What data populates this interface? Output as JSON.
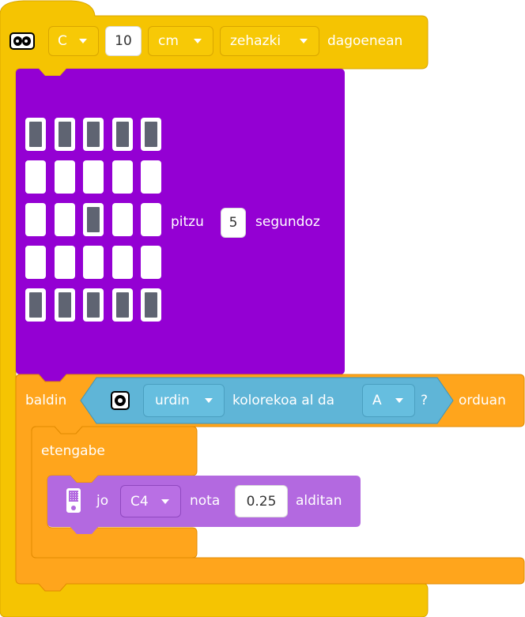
{
  "colors": {
    "sensor_block": "#F5C402",
    "sensor_block_border": "#D9A600",
    "light_block": "#9400D3",
    "control_block": "#FFA51C",
    "control_block_border": "#E08A00",
    "color_sensor_block": "#5FB5D7",
    "sound_block": "#B369E0"
  },
  "hat_block": {
    "icon": "distance-sensor-icon",
    "port": "C",
    "distance_value": "10",
    "unit": "cm",
    "comparison": "zehazki",
    "suffix_label": "dagoenean"
  },
  "light_block": {
    "matrix": [
      [
        1,
        1,
        1,
        1,
        1
      ],
      [
        0,
        0,
        0,
        0,
        0
      ],
      [
        0,
        0,
        1,
        0,
        0
      ],
      [
        0,
        0,
        0,
        0,
        0
      ],
      [
        1,
        1,
        1,
        1,
        1
      ]
    ],
    "action_label": "pitzu",
    "duration_value": "5",
    "unit_label": "segundoz"
  },
  "if_block": {
    "if_label": "baldin",
    "then_label": "orduan",
    "condition": {
      "icon": "color-sensor-icon",
      "color_option": "urdin",
      "question_label": "kolorekoa al da",
      "port": "A",
      "question_mark": "?"
    }
  },
  "forever_block": {
    "label": "etengabe"
  },
  "sound_block": {
    "icon": "hub-speaker-icon",
    "play_label": "jo",
    "note_value": "C4",
    "note_label": "nota",
    "duration_value": "0.25",
    "times_label": "alditan"
  }
}
